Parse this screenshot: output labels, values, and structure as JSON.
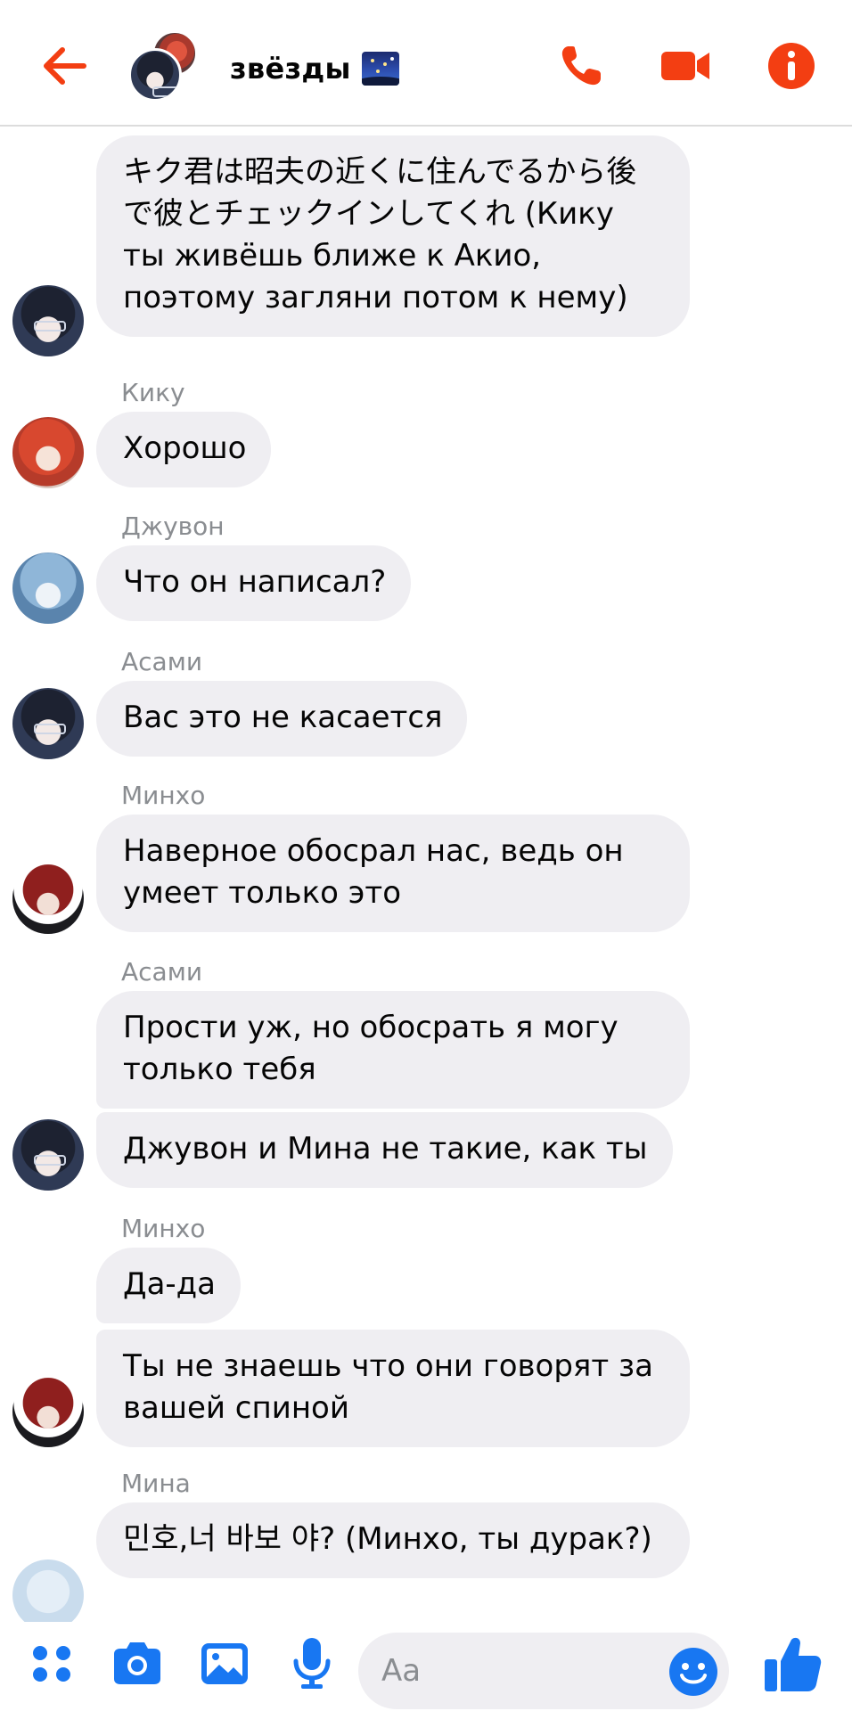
{
  "header": {
    "title": "звёзды",
    "title_emoji": "night-sky-emoji",
    "accent_color": "#f33e12",
    "icons": [
      "back-arrow-icon",
      "phone-icon",
      "video-camera-icon",
      "info-icon"
    ]
  },
  "messages": [
    {
      "sender": "",
      "avatar": "asami",
      "text": "キク君は昭夫の近くに住んでるから後で彼とチェックインしてくれ (Кику ты живёшь ближе к Акио, поэтому загляни потом к нему)"
    },
    {
      "sender": "Кику",
      "avatar": "kiku",
      "text": "Хорошо"
    },
    {
      "sender": "Джувон",
      "avatar": "jiwon",
      "text": "Что он написал?"
    },
    {
      "sender": "Асами",
      "avatar": "asami",
      "text": "Вас это не касается"
    },
    {
      "sender": "Минхо",
      "avatar": "minho",
      "text": "Наверное обосрал нас, ведь он умеет только это"
    },
    {
      "sender": "Асами",
      "avatar": "asami",
      "text": "Прости уж, но обосрать я могу только тебя"
    },
    {
      "sender": "",
      "avatar": "asami",
      "text": "Джувон и Мина не такие, как ты"
    },
    {
      "sender": "Минхо",
      "avatar": "minho",
      "text": "Да-да"
    },
    {
      "sender": "",
      "avatar": "minho",
      "text": "Ты не знаешь что они говорят за вашей спиной"
    },
    {
      "sender": "Мина",
      "avatar": "mina",
      "text": "민호,너 바보 야? (Минхо, ты дурак?)"
    }
  ],
  "composer": {
    "placeholder": "Aa",
    "icons": [
      "apps-grid-icon",
      "camera-icon",
      "gallery-icon",
      "microphone-icon",
      "emoji-icon",
      "thumbs-up-icon"
    ],
    "accent_color": "#1877f2"
  }
}
